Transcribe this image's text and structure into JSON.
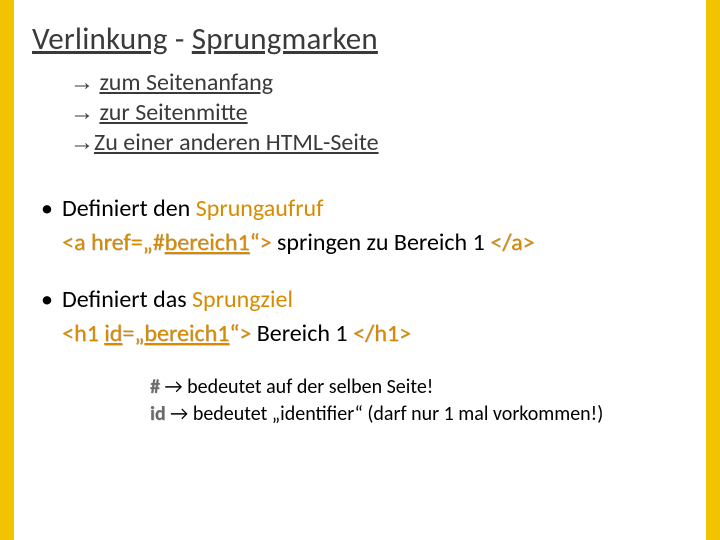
{
  "title": {
    "part1": "Verlinkung",
    "dash": " - ",
    "part2": "Sprungmarken"
  },
  "links": {
    "arrow": "→",
    "l1": "zum Seitenanfang",
    "l2": "zur Seitenmitte",
    "l3": "Zu einer anderen HTML-Seite"
  },
  "b1": {
    "line1a": "Definiert den ",
    "line1b": "Sprungaufruf",
    "code_open": "<a href=„#",
    "code_mid": "bereich1",
    "code_close": "“>",
    "text": " springen zu Bereich 1 ",
    "code_end": "</a>"
  },
  "b2": {
    "line1a": "Definiert das ",
    "line1b": "Sprungziel",
    "code_open": "<h1 ",
    "code_idkey": "id",
    "code_eq": "=„",
    "code_mid": "bereich1",
    "code_close": "“>",
    "text": " Bereich 1 ",
    "code_end": "</h1>"
  },
  "notes": {
    "n1_sym": "#",
    "n1_arrow": " → ",
    "n1_text": "bedeutet auf der selben Seite!",
    "n2_sym": "id",
    "n2_arrow": " → ",
    "n2_text": "bedeutet „identifier“ (darf nur 1 mal vorkommen!)"
  }
}
